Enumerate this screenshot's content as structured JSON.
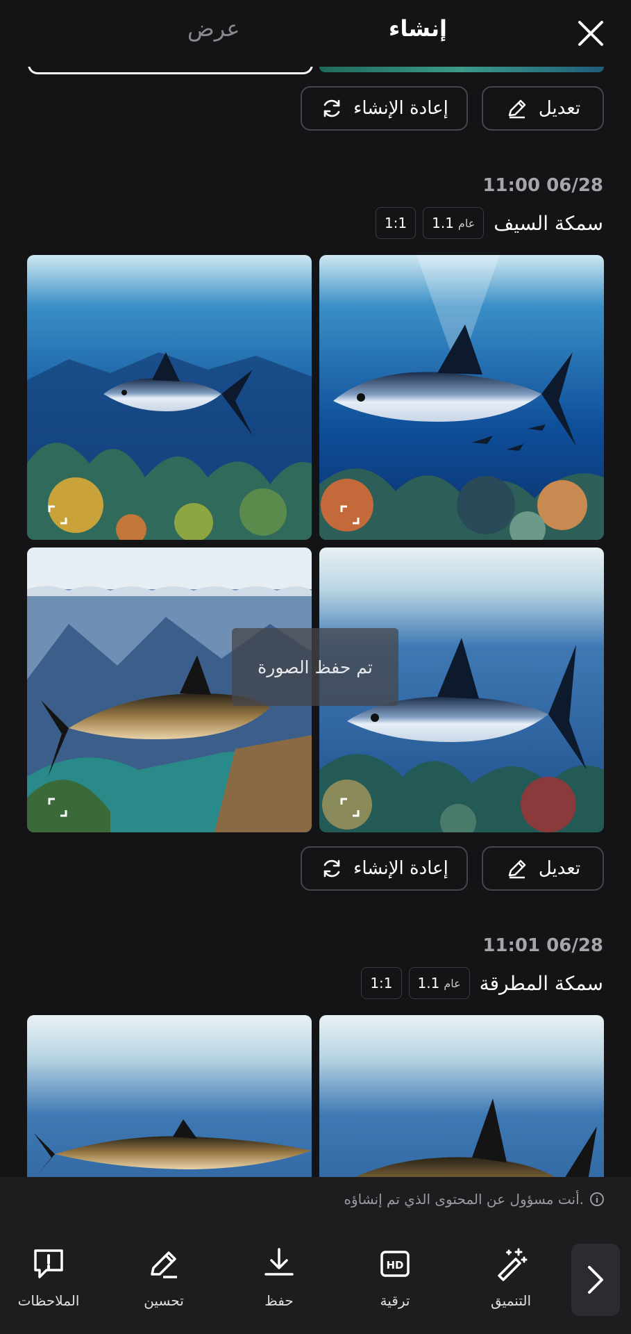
{
  "header": {
    "tab_view": "عرض",
    "tab_create": "إنشاء"
  },
  "actions": {
    "edit": "تعديل",
    "regenerate": "إعادة الإنشاء"
  },
  "groups": [
    {
      "timestamp": "11:00 06/28",
      "title": "سمكة السيف",
      "model": "1.1",
      "model_label": "عام",
      "ratio": "1:1"
    },
    {
      "timestamp": "11:01 06/28",
      "title": "سمكة المطرقة",
      "model": "1.1",
      "model_label": "عام",
      "ratio": "1:1"
    }
  ],
  "toast": "تم حفظ الصورة",
  "disclaimer": "أنت مسؤول عن المحتوى الذي تم إنشاؤه.",
  "toolbar": {
    "feedback": "الملاحظات",
    "improve": "تحسين",
    "save": "حفظ",
    "upscale": "ترقية",
    "retouch": "التنميق"
  },
  "colors": {
    "background": "#141416",
    "panel": "#1d1d20",
    "border": "#45464b"
  }
}
